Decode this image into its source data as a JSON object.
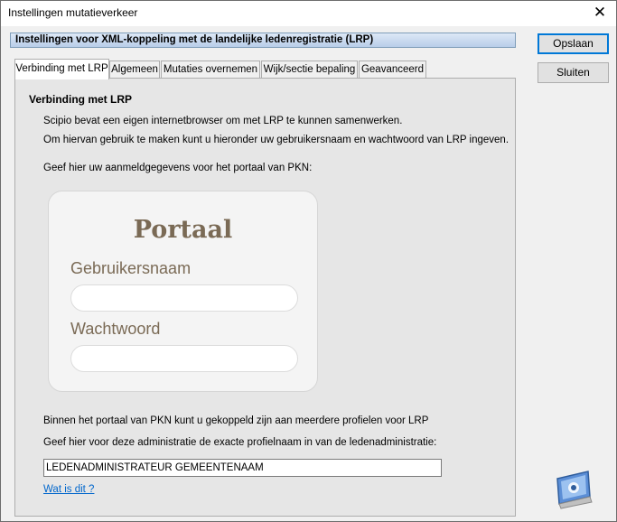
{
  "window": {
    "title": "Instellingen mutatieverkeer",
    "close_glyph": "✕"
  },
  "header": {
    "text": "Instellingen voor XML-koppeling met de landelijke ledenregistratie (LRP)"
  },
  "buttons": {
    "save": "Opslaan",
    "close": "Sluiten"
  },
  "tabs": [
    {
      "label": "Verbinding met LRP",
      "active": true
    },
    {
      "label": "Algemeen",
      "active": false
    },
    {
      "label": "Mutaties overnemen",
      "active": false
    },
    {
      "label": "Wijk/sectie bepaling",
      "active": false
    },
    {
      "label": "Geavanceerd",
      "active": false
    }
  ],
  "panel": {
    "section_title": "Verbinding met LRP",
    "intro_line1": "Scipio bevat een eigen internetbrowser om met LRP te kunnen samenwerken.",
    "intro_line2": "Om hiervan gebruik te maken kunt u hieronder uw gebruikersnaam en wachtwoord van LRP ingeven.",
    "credentials_prompt": "Geef hier uw aanmeldgegevens voor het portaal van PKN:",
    "portal": {
      "title": "Portaal",
      "username_label": "Gebruikersnaam",
      "username_value": "",
      "password_label": "Wachtwoord",
      "password_value": ""
    },
    "profiles_line": "Binnen het portaal van PKN kunt u gekoppeld zijn aan meerdere profielen voor LRP",
    "profile_prompt": "Geef hier voor deze administratie de exacte profielnaam in van de ledenadministratie:",
    "profile_value": "LEDENADMINISTRATEUR GEMEENTENAAM",
    "help_link": "Wat is dit ?"
  },
  "logo_icon": "scipio-logo-icon",
  "colors": {
    "link": "#0066cc",
    "portal_text": "#7a6a55",
    "header_gradient_top": "#dde8f6",
    "header_gradient_bottom": "#b8cde9"
  }
}
